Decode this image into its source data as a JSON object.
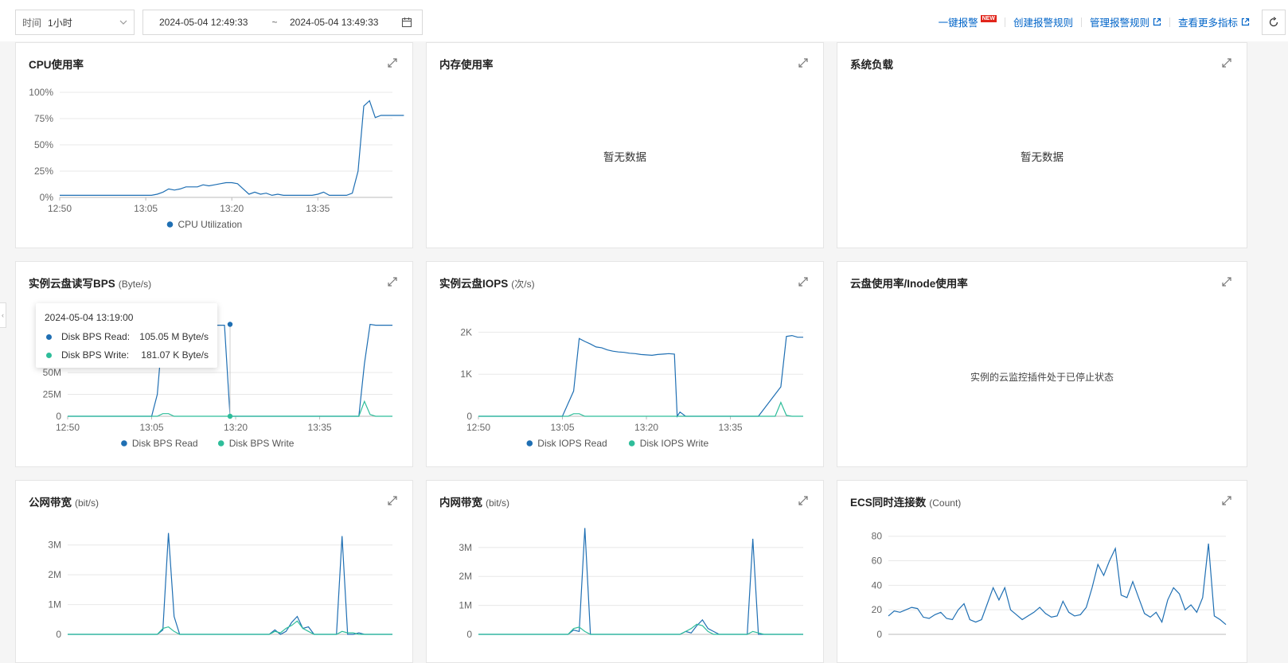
{
  "toolbar": {
    "time_label": "时间",
    "time_value": "1小时",
    "range_start": "2024-05-04 12:49:33",
    "range_sep": "~",
    "range_end": "2024-05-04 13:49:33",
    "links": {
      "one_click_alarm": "一键报警",
      "new_badge": "NEW",
      "create_rule": "创建报警规则",
      "manage_rule": "管理报警规则",
      "more_metrics": "查看更多指标"
    }
  },
  "colors": {
    "read": "#1f6fb3",
    "write": "#2ebd9a",
    "link": "#0064c8",
    "grid": "#e8e8e8"
  },
  "panels": {
    "cpu": {
      "title": "CPU使用率"
    },
    "mem": {
      "title": "内存使用率",
      "nodata": "暂无数据"
    },
    "load": {
      "title": "系统负载",
      "nodata": "暂无数据"
    },
    "bps": {
      "title": "实例云盘读写BPS",
      "unit": "(Byte/s)"
    },
    "iops": {
      "title": "实例云盘IOPS",
      "unit": "(次/s)"
    },
    "disk": {
      "title": "云盘使用率/Inode使用率",
      "nodata": "实例的云监控插件处于已停止状态"
    },
    "pub": {
      "title": "公网带宽",
      "unit": "(bit/s)"
    },
    "intr": {
      "title": "内网带宽",
      "unit": "(bit/s)"
    },
    "conn": {
      "title": "ECS同时连接数",
      "unit": "(Count)"
    }
  },
  "tooltip": {
    "time": "2024-05-04 13:19:00",
    "rows": [
      {
        "name": "Disk BPS Read:",
        "value": "105.05 M Byte/s"
      },
      {
        "name": "Disk BPS Write:",
        "value": "181.07 K Byte/s"
      }
    ]
  },
  "chart_data": [
    {
      "id": "cpu",
      "type": "line",
      "xticks": [
        "12:50",
        "13:05",
        "13:20",
        "13:35"
      ],
      "yticks": [
        "0%",
        "25%",
        "50%",
        "75%",
        "100%"
      ],
      "ylim": [
        0,
        100
      ],
      "series": [
        {
          "name": "CPU Utilization",
          "color": "#1f6fb3",
          "x": [
            0,
            2,
            4,
            6,
            8,
            10,
            12,
            14,
            16,
            17,
            18,
            19,
            20,
            21,
            22,
            23,
            24,
            25,
            26,
            27,
            28,
            29,
            30,
            31,
            32,
            33,
            34,
            35,
            36,
            37,
            38,
            39,
            40,
            41,
            42,
            43,
            44,
            45,
            46,
            47,
            48,
            49,
            50,
            51,
            52,
            53,
            54,
            55,
            56,
            57,
            58,
            59,
            60
          ],
          "y": [
            2,
            2,
            2,
            2,
            2,
            2,
            2,
            2,
            2,
            3,
            5,
            8,
            7,
            8,
            10,
            10,
            10,
            12,
            11,
            12,
            13,
            14,
            14,
            13,
            8,
            3,
            5,
            3,
            4,
            2,
            3,
            2,
            2,
            2,
            2,
            2,
            2,
            3,
            5,
            2,
            2,
            2,
            2,
            4,
            25,
            87,
            92,
            76,
            78,
            78,
            78,
            78,
            78
          ]
        }
      ]
    },
    {
      "id": "bps",
      "type": "line",
      "xticks": [
        "12:50",
        "13:05",
        "13:20",
        "13:35"
      ],
      "yticks": [
        "0",
        "25M",
        "50M"
      ],
      "ylim": [
        0,
        120
      ],
      "series": [
        {
          "name": "Disk BPS Read",
          "color": "#1f6fb3",
          "x": [
            0,
            8,
            15,
            16,
            17,
            18,
            19,
            20,
            21,
            22,
            23,
            24,
            25,
            26,
            27,
            28,
            29,
            30,
            32,
            34,
            36,
            38,
            40,
            42,
            44,
            46,
            48,
            50,
            52,
            53,
            54,
            55,
            56,
            57,
            58
          ],
          "y": [
            0,
            0,
            0,
            25,
            100,
            103,
            104,
            104,
            105,
            105,
            105,
            105,
            104,
            104,
            104,
            104,
            0,
            0,
            0,
            0,
            0,
            0,
            0,
            0,
            0,
            0,
            0,
            0,
            0,
            60,
            105,
            104,
            104,
            104,
            104
          ]
        },
        {
          "name": "Disk BPS Write",
          "color": "#2ebd9a",
          "x": [
            0,
            16,
            17,
            18,
            19,
            20,
            30,
            40,
            50,
            52,
            53,
            54,
            55,
            56,
            58
          ],
          "y": [
            0,
            0,
            3,
            3,
            0,
            0,
            0,
            0,
            0,
            0,
            17,
            2,
            0,
            0,
            0
          ]
        }
      ]
    },
    {
      "id": "iops",
      "type": "line",
      "xticks": [
        "12:50",
        "13:05",
        "13:20",
        "13:35"
      ],
      "yticks": [
        "0",
        "1K",
        "2K"
      ],
      "ylim": [
        0,
        2500
      ],
      "series": [
        {
          "name": "Disk IOPS Read",
          "color": "#1f6fb3",
          "x": [
            0,
            5,
            10,
            15,
            17,
            18,
            19,
            20,
            21,
            22,
            23,
            24,
            25,
            26,
            27,
            28,
            29,
            30,
            31,
            32,
            33,
            34,
            35,
            35.5,
            36,
            37,
            38,
            40,
            45,
            50,
            54,
            55,
            56,
            57,
            58
          ],
          "y": [
            0,
            0,
            0,
            0,
            600,
            1850,
            1780,
            1720,
            1650,
            1630,
            1580,
            1550,
            1530,
            1520,
            1500,
            1490,
            1470,
            1460,
            1450,
            1470,
            1480,
            1490,
            1480,
            0,
            100,
            0,
            0,
            0,
            0,
            0,
            700,
            1900,
            1920,
            1880,
            1880
          ]
        },
        {
          "name": "Disk IOPS Write",
          "color": "#2ebd9a",
          "x": [
            0,
            16,
            17,
            18,
            19,
            20,
            30,
            40,
            53,
            54,
            55,
            56,
            58
          ],
          "y": [
            0,
            0,
            60,
            60,
            0,
            0,
            0,
            0,
            0,
            330,
            20,
            0,
            0
          ]
        }
      ]
    },
    {
      "id": "pub",
      "type": "line",
      "yticks": [
        "0",
        "1M",
        "2M",
        "3M"
      ],
      "ylim": [
        0,
        3.5
      ],
      "series": [
        {
          "name": "",
          "color": "#1f6fb3",
          "x": [
            0,
            10,
            16,
            17,
            18,
            19,
            20,
            30,
            36,
            37,
            38,
            39,
            40,
            41,
            42,
            43,
            44,
            45,
            48,
            49,
            50,
            51,
            52,
            53,
            54,
            55,
            56,
            57,
            58
          ],
          "y": [
            0,
            0,
            0,
            0.15,
            3.4,
            0.6,
            0,
            0,
            0,
            0.15,
            0,
            0.1,
            0.4,
            0.6,
            0.2,
            0.25,
            0,
            0,
            0,
            3.3,
            0,
            0,
            0.05,
            0,
            0,
            0,
            0,
            0,
            0
          ]
        },
        {
          "name": "",
          "color": "#2ebd9a",
          "x": [
            0,
            16,
            17,
            18,
            19,
            20,
            30,
            36,
            37,
            38,
            39,
            40,
            41,
            42,
            43,
            44,
            48,
            49,
            50,
            51,
            52,
            54,
            58
          ],
          "y": [
            0,
            0,
            0.2,
            0.25,
            0.1,
            0,
            0,
            0,
            0.1,
            0.05,
            0.2,
            0.3,
            0.45,
            0.2,
            0.1,
            0,
            0,
            0.1,
            0.05,
            0.05,
            0,
            0,
            0
          ]
        }
      ]
    },
    {
      "id": "intr",
      "type": "line",
      "yticks": [
        "0",
        "1M",
        "2M",
        "3M"
      ],
      "ylim": [
        0,
        3.6
      ],
      "series": [
        {
          "name": "",
          "color": "#1f6fb3",
          "x": [
            0,
            10,
            16,
            17,
            18,
            19,
            20,
            30,
            36,
            37,
            38,
            39,
            40,
            41,
            42,
            43,
            44,
            45,
            48,
            49,
            50,
            51,
            52,
            54,
            58
          ],
          "y": [
            0,
            0,
            0,
            0.15,
            0.1,
            3.8,
            0,
            0,
            0,
            0.1,
            0.05,
            0.3,
            0.5,
            0.2,
            0.1,
            0,
            0,
            0,
            0,
            3.3,
            0,
            0,
            0,
            0,
            0
          ]
        },
        {
          "name": "",
          "color": "#2ebd9a",
          "x": [
            0,
            16,
            17,
            18,
            19,
            20,
            30,
            36,
            37,
            38,
            39,
            40,
            41,
            42,
            48,
            49,
            50,
            51,
            54,
            58
          ],
          "y": [
            0,
            0,
            0.2,
            0.25,
            0.1,
            0,
            0,
            0,
            0.1,
            0.2,
            0.35,
            0.3,
            0.1,
            0,
            0,
            0.1,
            0.05,
            0,
            0,
            0
          ]
        }
      ]
    },
    {
      "id": "conn",
      "type": "line",
      "yticks": [
        "0",
        "20",
        "40",
        "60",
        "80"
      ],
      "ylim": [
        0,
        85
      ],
      "series": [
        {
          "name": "",
          "color": "#1f6fb3",
          "x": [
            0,
            1,
            2,
            3,
            4,
            5,
            6,
            7,
            8,
            9,
            10,
            11,
            12,
            13,
            14,
            15,
            16,
            17,
            18,
            19,
            20,
            21,
            22,
            23,
            24,
            25,
            26,
            27,
            28,
            29,
            30,
            31,
            32,
            33,
            34,
            35,
            36,
            37,
            38,
            39,
            40,
            41,
            42,
            43,
            44,
            45,
            46,
            47,
            48,
            49,
            50,
            51,
            52,
            53,
            54,
            55,
            56,
            57,
            58
          ],
          "y": [
            15,
            19,
            18,
            20,
            22,
            21,
            14,
            13,
            16,
            18,
            13,
            12,
            20,
            25,
            12,
            10,
            12,
            25,
            38,
            28,
            38,
            20,
            16,
            12,
            15,
            18,
            22,
            17,
            14,
            15,
            27,
            18,
            15,
            16,
            22,
            38,
            57,
            48,
            60,
            70,
            32,
            30,
            43,
            30,
            17,
            14,
            18,
            10,
            28,
            38,
            33,
            20,
            24,
            18,
            30,
            74,
            15,
            12,
            8
          ]
        }
      ]
    }
  ],
  "legends": {
    "cpu": [
      "CPU Utilization"
    ],
    "bps": [
      "Disk BPS Read",
      "Disk BPS Write"
    ],
    "iops": [
      "Disk IOPS Read",
      "Disk IOPS Write"
    ]
  }
}
